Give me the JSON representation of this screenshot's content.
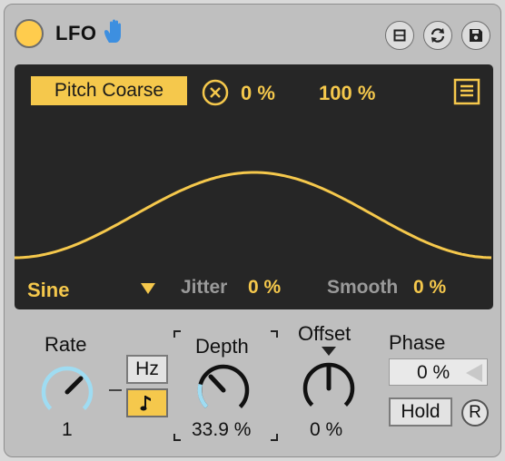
{
  "title_bar": {
    "title": "LFO",
    "icons": [
      "hand-icon",
      "expand-icon",
      "hot-swap-icon",
      "save-icon"
    ]
  },
  "display": {
    "mapped_parameter": "Pitch Coarse",
    "range_min": "0 %",
    "range_max": "100 %",
    "waveform": "Sine",
    "jitter_label": "Jitter",
    "jitter_value": "0 %",
    "smooth_label": "Smooth",
    "smooth_value": "0 %"
  },
  "controls": {
    "rate_label": "Rate",
    "rate_value": "1",
    "hz_label": "Hz",
    "depth_label": "Depth",
    "depth_value": "33.9 %",
    "offset_label": "Offset",
    "offset_value": "0 %",
    "phase_label": "Phase",
    "phase_value": "0 %",
    "hold_label": "Hold",
    "retrigger_label": "R"
  },
  "colors": {
    "accent": "#f5c84c",
    "display_bg": "#262626",
    "knob_arc": "#9fdcf2",
    "device_bg": "#bfbfbf"
  }
}
